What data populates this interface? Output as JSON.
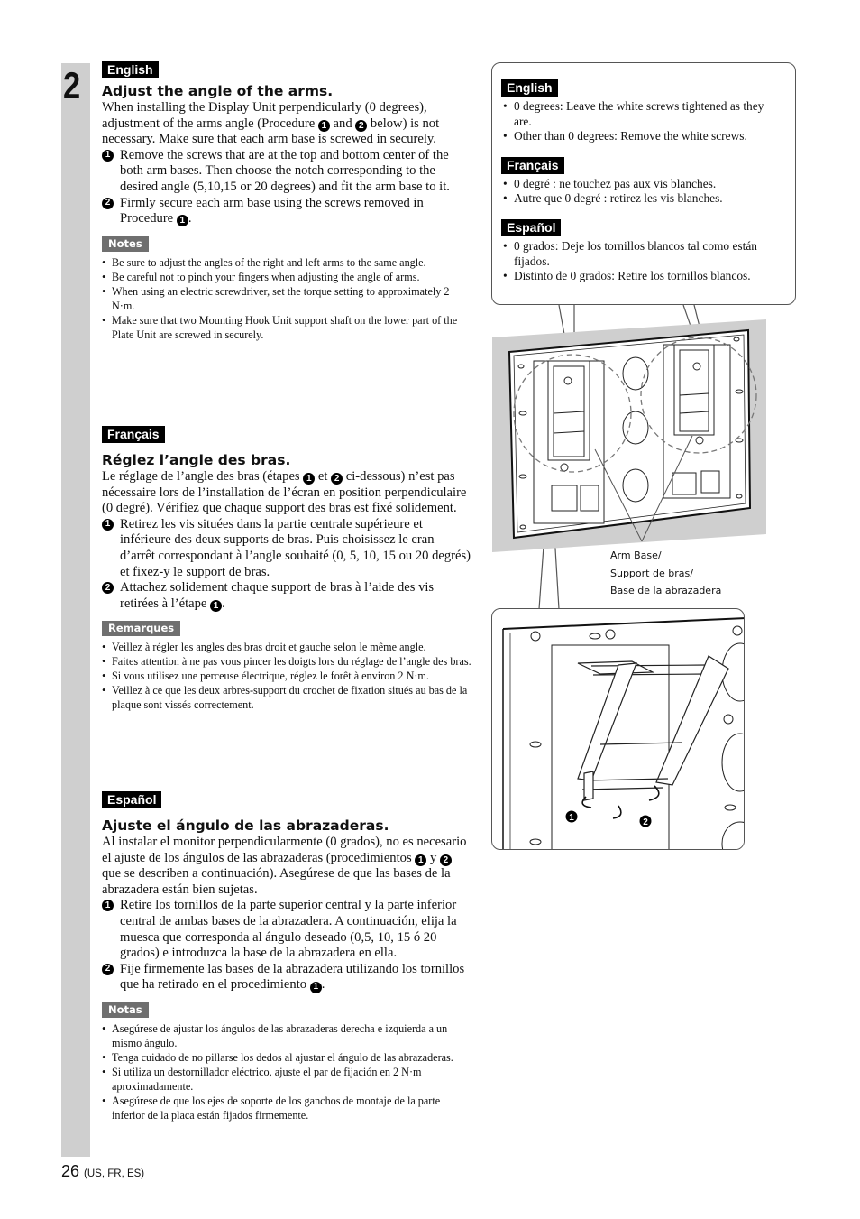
{
  "page": {
    "step_number": "2",
    "page_number": "26",
    "page_locale": "(US, FR, ES)"
  },
  "sections": [
    {
      "lang": "English",
      "heading": "Adjust the angle of the arms.",
      "intro_parts": [
        "When installing the Display Unit perpendicularly (0 degrees), adjustment of the arms angle (Procedure ",
        "1",
        " and ",
        "2",
        " below) is not necessary. Make sure that each arm base is screwed in securely."
      ],
      "steps": [
        {
          "num": "1",
          "text": "Remove the screws that are at the top and bottom center of the both arm bases. Then choose the notch corresponding to the desired angle (5,10,15 or 20 degrees) and fit the arm base to it."
        },
        {
          "num": "2",
          "text_before": "Firmly secure each arm base using the screws removed in Procedure ",
          "ref": "1",
          "text_after": "."
        }
      ],
      "notes_label": "Notes",
      "notes": [
        "Be sure to adjust the angles of the right and left arms to the same angle.",
        "Be careful not to pinch your fingers when adjusting the angle of arms.",
        "When using an electric screwdriver, set the torque setting to approximately 2 N·m.",
        "Make sure that two Mounting Hook Unit support shaft on the lower part of the Plate Unit are screwed in securely."
      ]
    },
    {
      "lang": "Français",
      "heading": "Réglez l’angle des bras.",
      "intro_parts": [
        "Le réglage de l’angle des bras (étapes ",
        "1",
        " et ",
        "2",
        " ci-dessous) n’est pas nécessaire lors de l’installation de l’écran en position perpendiculaire (0 degré). Vérifiez que chaque support des bras est fixé solidement."
      ],
      "steps": [
        {
          "num": "1",
          "text": "Retirez les vis situées dans la partie centrale supérieure et inférieure des deux supports de bras. Puis choisissez le cran d’arrêt correspondant à l’angle souhaité (0, 5, 10, 15 ou 20 degrés) et fixez-y le support de bras."
        },
        {
          "num": "2",
          "text_before": "Attachez solidement chaque support de bras à l’aide des vis retirées à l’étape ",
          "ref": "1",
          "text_after": "."
        }
      ],
      "notes_label": "Remarques",
      "notes": [
        "Veillez à régler les angles des bras droit et gauche selon le même angle.",
        "Faites attention à ne pas vous pincer les doigts lors du réglage de l’angle des bras.",
        "Si vous utilisez une perceuse électrique, réglez le forêt à environ 2 N·m.",
        "Veillez à ce que les deux arbres-support du crochet de fixation situés au bas de la plaque sont vissés correctement."
      ]
    },
    {
      "lang": "Español",
      "heading": "Ajuste el ángulo de las abrazaderas.",
      "intro_parts": [
        "Al instalar el monitor perpendicularmente (0 grados), no es necesario el ajuste de los ángulos de las abrazaderas (procedimientos ",
        "1",
        " y ",
        "2",
        " que se describen a continuación). Asegúrese de que las bases de la abrazadera están bien sujetas."
      ],
      "steps": [
        {
          "num": "1",
          "text": "Retire los tornillos de la parte superior central y la parte inferior central de ambas bases de la abrazadera.  A continuación, elija la muesca que corresponda al ángulo deseado (0,5, 10, 15 ó 20 grados) e introduzca la base de la abrazadera en ella."
        },
        {
          "num": "2",
          "text_before": "Fije firmemente las bases de la abrazadera utilizando los tornillos que ha retirado en el procedimiento ",
          "ref": "1",
          "text_after": "."
        }
      ],
      "notes_label": "Notas",
      "notes": [
        "Asegúrese de ajustar los ángulos de las abrazaderas derecha e izquierda a un mismo ángulo.",
        "Tenga cuidado de no pillarse los dedos al ajustar el ángulo de las abrazaderas.",
        "Si utiliza un destornillador eléctrico, ajuste el par de fijación en 2 N·m aproximadamente.",
        "Asegúrese de que los ejes de soporte de los ganchos de montaje de la parte inferior de la placa están fijados firmemente."
      ]
    }
  ],
  "callout": [
    {
      "lang": "English",
      "items": [
        "0 degrees: Leave the white screws tightened as they are.",
        "Other than 0 degrees: Remove the white screws."
      ]
    },
    {
      "lang": "Français",
      "items": [
        "0 degré : ne touchez pas aux vis blanches.",
        "Autre que 0 degré : retirez les vis blanches."
      ]
    },
    {
      "lang": "Español",
      "items": [
        "0 grados: Deje los tornillos blancos tal como están fijados.",
        "Distinto de 0 grados: Retire los tornillos blancos."
      ]
    }
  ],
  "figure": {
    "label_lines": [
      "Arm Base/",
      "Support de bras/",
      "Base de la abrazadera"
    ],
    "detail_markers": [
      "1",
      "2"
    ]
  }
}
